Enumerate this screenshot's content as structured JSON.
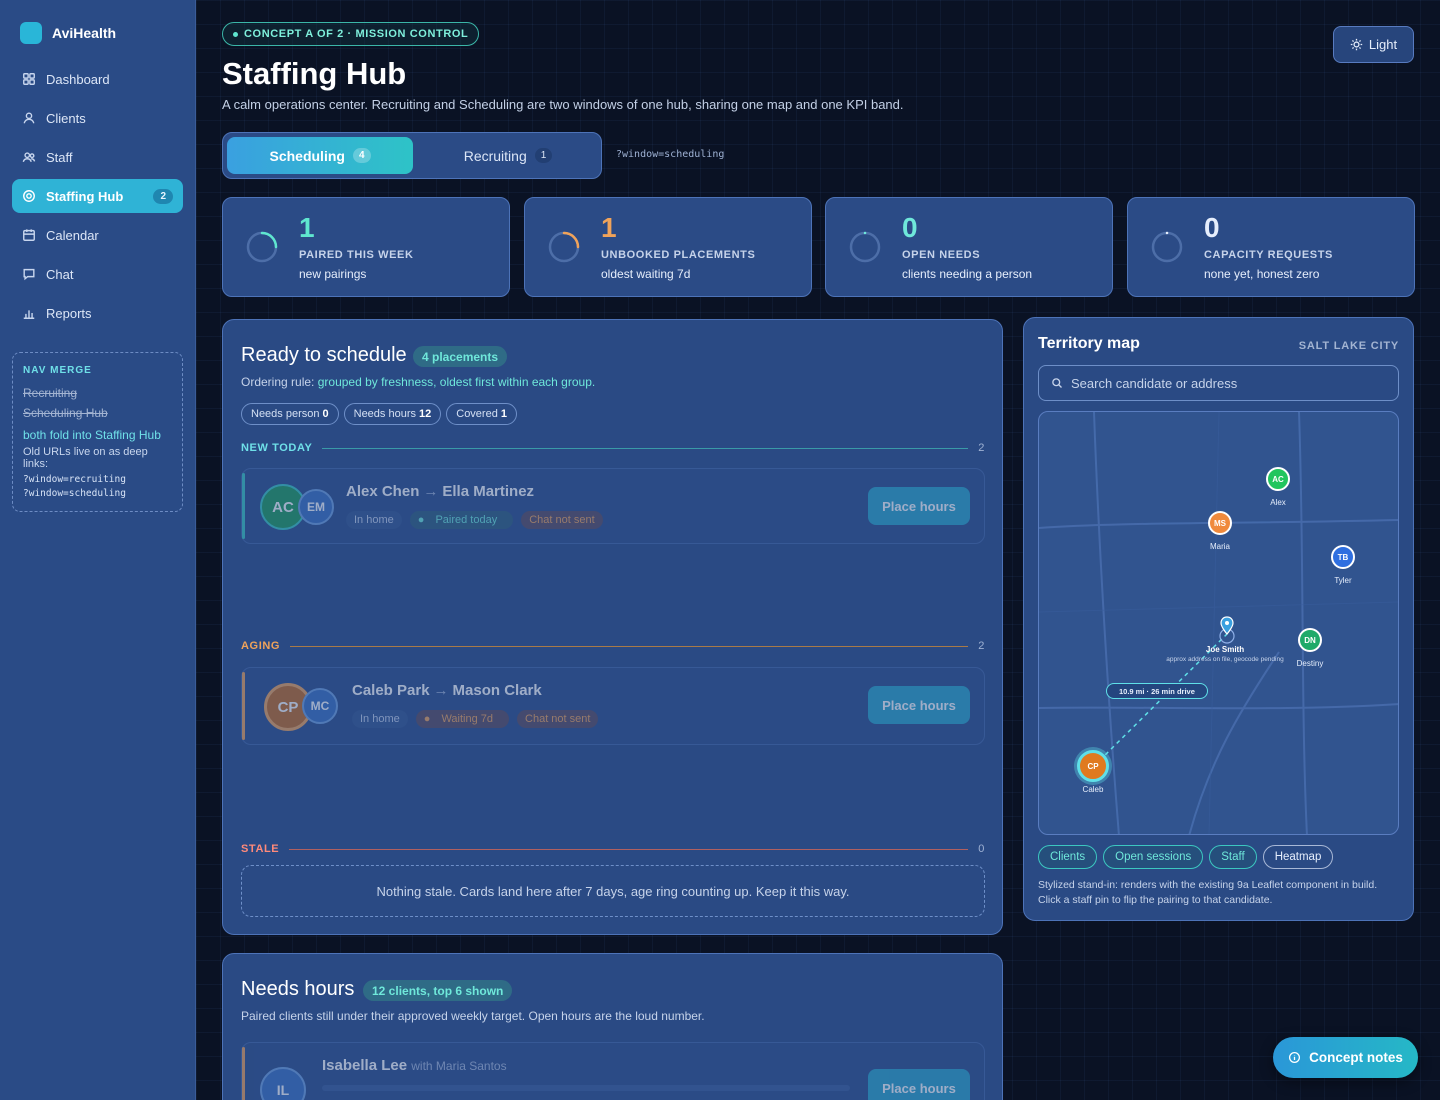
{
  "app": {
    "name": "AviHealth"
  },
  "sidebar": {
    "items": [
      {
        "label": "Dashboard",
        "icon": "grid-icon"
      },
      {
        "label": "Clients",
        "icon": "user-icon"
      },
      {
        "label": "Staff",
        "icon": "users-icon"
      },
      {
        "label": "Staffing Hub",
        "icon": "target-icon",
        "badge": "2",
        "active": true
      },
      {
        "label": "Calendar",
        "icon": "calendar-icon"
      },
      {
        "label": "Chat",
        "icon": "chat-icon"
      },
      {
        "label": "Reports",
        "icon": "bar-chart-icon"
      }
    ],
    "merge": {
      "heading": "NAV MERGE",
      "old1": "Recruiting",
      "old2": "Scheduling Hub",
      "fold": "both fold into Staffing Hub",
      "note": "Old URLs live on as deep links:",
      "link1": "?window=recruiting",
      "link2": "?window=scheduling"
    }
  },
  "header": {
    "pill": "CONCEPT A OF 2 · MISSION CONTROL",
    "title": "Staffing Hub",
    "subtitle": "A calm operations center. Recruiting and Scheduling are two windows of one hub, sharing one map and one KPI band.",
    "theme_toggle": "Light"
  },
  "tabs": {
    "items": [
      {
        "label": "Scheduling",
        "count": "4"
      },
      {
        "label": "Recruiting",
        "count": "1"
      }
    ],
    "hint": "?window=scheduling"
  },
  "kpis": [
    {
      "value": "1",
      "label": "PAIRED THIS WEEK",
      "sub": "new pairings",
      "color": "#5fe6cf",
      "progress": 0.25
    },
    {
      "value": "1",
      "label": "UNBOOKED PLACEMENTS",
      "sub": "oldest waiting 7d",
      "color": "#f0a35a",
      "progress": 0.25
    },
    {
      "value": "0",
      "label": "OPEN NEEDS",
      "sub": "clients needing a person",
      "color": "#6fe8da",
      "progress": 0
    },
    {
      "value": "0",
      "label": "CAPACITY REQUESTS",
      "sub": "none yet, honest zero",
      "color": "#e6eefc",
      "progress": 0
    }
  ],
  "ready": {
    "title": "Ready to schedule",
    "tag": "4 placements",
    "rule_prefix": "Ordering rule:",
    "rule_value": "grouped by freshness, oldest first within each group.",
    "chips": [
      {
        "label": "Needs person",
        "count": "0"
      },
      {
        "label": "Needs hours",
        "count": "12"
      },
      {
        "label": "Covered",
        "count": "1"
      }
    ],
    "groups": {
      "new_today": {
        "label": "NEW TODAY",
        "count": "2",
        "color": "#6fe0e8"
      },
      "aging": {
        "label": "AGING",
        "count": "2",
        "color": "#f0a35a"
      },
      "stale": {
        "label": "STALE",
        "count": "0",
        "color": "#ff8a7a"
      }
    },
    "cards": [
      {
        "a": "AC",
        "b": "EM",
        "from": "Alex Chen",
        "to": "Ella Martinez",
        "m1": "In home",
        "m2": "Paired today",
        "m3": "Chat not sent",
        "button": "Place hours"
      },
      {
        "a": "CP",
        "b": "MC",
        "from": "Caleb Park",
        "to": "Mason Clark",
        "m1": "In home",
        "m2": "Waiting 7d",
        "m3": "Chat not sent",
        "button": "Place hours"
      }
    ],
    "stale_empty": "Nothing stale. Cards land here after 7 days, age ring counting up. Keep it this way."
  },
  "needs_hours": {
    "title": "Needs hours",
    "tag": "12 clients, top 6 shown",
    "sub": "Paired clients still under their approved weekly target. Open hours are the loud number.",
    "first": {
      "initials": "IL",
      "name": "Isabella Lee",
      "with": "with Maria Santos",
      "button": "Place hours"
    }
  },
  "map": {
    "title": "Territory map",
    "city": "SALT LAKE CITY",
    "search_placeholder": "Search candidate or address",
    "pins": [
      {
        "initials": "AC",
        "name": "Alex",
        "color": "#22c55e"
      },
      {
        "initials": "MS",
        "name": "Maria",
        "color": "#f08a3c"
      },
      {
        "initials": "TB",
        "name": "Tyler",
        "color": "#2f6fe0"
      },
      {
        "initials": "DN",
        "name": "Destiny",
        "color": "#1faa6a"
      },
      {
        "initials": "CP",
        "name": "Caleb",
        "color": "#e07a1f"
      }
    ],
    "client": {
      "name": "Joe Smith",
      "note": "approx address on file, geocode pending"
    },
    "route": "10.9 mi · 26 min drive",
    "chips": [
      "Clients",
      "Open sessions",
      "Staff",
      "Heatmap"
    ],
    "note": "Stylized stand-in: renders with the existing 9a Leaflet component in build. Click a staff pin to flip the pairing to that candidate."
  },
  "concept_notes": "Concept notes"
}
